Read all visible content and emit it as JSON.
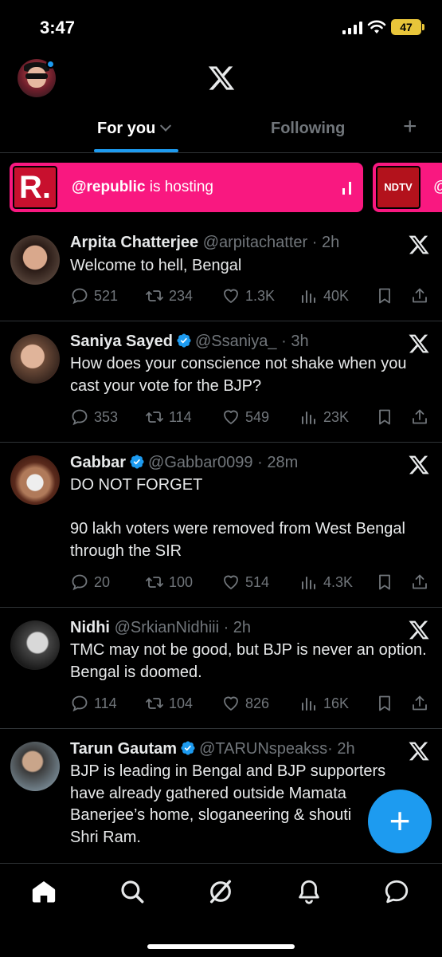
{
  "status_bar": {
    "time": "3:47",
    "battery": "47"
  },
  "header": {
    "logo": "X",
    "avatar": "profile-avatar"
  },
  "tabs": {
    "for_you": "For you",
    "following": "Following",
    "add": "+"
  },
  "spaces": [
    {
      "handle": "@republic",
      "suffix": " is hosting",
      "logo_text": "R.",
      "color": "#f91880"
    },
    {
      "handle": "@",
      "logo_text": "NDTV",
      "color": "#f91880"
    }
  ],
  "tweets": [
    {
      "name": "Arpita Chatterjee",
      "verified": false,
      "handle": "@arpitachatter",
      "time": "· 2h",
      "text": "Welcome to hell, Bengal",
      "replies": "521",
      "retweets": "234",
      "likes": "1.3K",
      "views": "40K"
    },
    {
      "name": "Saniya Sayed",
      "verified": true,
      "handle": "@Ssaniya_",
      "time": "· 3h",
      "text": "How does your conscience not shake when you cast your vote for the BJP?",
      "replies": "353",
      "retweets": "114",
      "likes": "549",
      "views": "23K"
    },
    {
      "name": "Gabbar",
      "verified": true,
      "handle": "@Gabbar0099",
      "time": "· 28m",
      "text": "DO NOT FORGET\n\n90 lakh voters were removed from West Bengal through the SIR",
      "replies": "20",
      "retweets": "100",
      "likes": "514",
      "views": "4.3K"
    },
    {
      "name": "Nidhi",
      "verified": false,
      "handle": "@SrkianNidhiii",
      "time": "· 2h",
      "text": "TMC may not be good, but BJP is never an option. Bengal is doomed.",
      "replies": "114",
      "retweets": "104",
      "likes": "826",
      "views": "16K"
    },
    {
      "name": "Tarun Gautam",
      "verified": true,
      "handle": "@TARUNspeakss",
      "time": "· 2h",
      "text": "BJP is leading in Bengal and BJP supporters have already gathered outside Mamata Banerjee’s home, sloganeering & shouti\nShri Ram."
    }
  ],
  "fab": {
    "label": "+"
  },
  "colors": {
    "accent": "#1d9bf0",
    "background": "#000000",
    "muted": "#71767b",
    "space_pink": "#f91880"
  }
}
